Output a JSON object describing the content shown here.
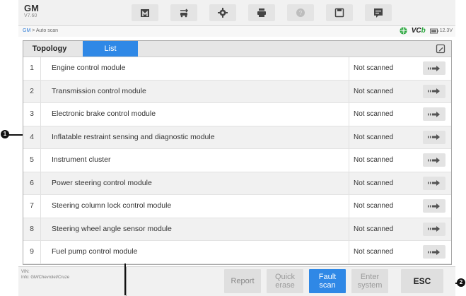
{
  "app": {
    "brand": "GM",
    "version": "V7.60"
  },
  "breadcrumb": {
    "root": "GM",
    "separator": " > ",
    "current": "Auto scan"
  },
  "status": {
    "vci_text": "VC",
    "vci_suffix": "b",
    "battery": "12.3V"
  },
  "toolbar": {
    "icons": [
      "home-icon",
      "vehicle-swap-icon",
      "gear-icon",
      "printer-icon",
      "help-icon",
      "save-icon",
      "data-logging-icon"
    ]
  },
  "tabs": [
    {
      "label": "Topology",
      "active": false
    },
    {
      "label": "List",
      "active": true
    }
  ],
  "modules": [
    {
      "num": "1",
      "name": "Engine control module",
      "status": "Not scanned"
    },
    {
      "num": "2",
      "name": "Transmission control module",
      "status": "Not scanned"
    },
    {
      "num": "3",
      "name": "Electronic brake control module",
      "status": "Not scanned"
    },
    {
      "num": "4",
      "name": "Inflatable restraint sensing and diagnostic module",
      "status": "Not scanned"
    },
    {
      "num": "5",
      "name": "Instrument cluster",
      "status": "Not scanned"
    },
    {
      "num": "6",
      "name": "Power steering control module",
      "status": "Not scanned"
    },
    {
      "num": "7",
      "name": "Steering column lock control module",
      "status": "Not scanned"
    },
    {
      "num": "8",
      "name": "Steering wheel angle sensor module",
      "status": "Not scanned"
    },
    {
      "num": "9",
      "name": "Fuel pump control module",
      "status": "Not scanned"
    }
  ],
  "vehicle": {
    "vin_label": "VIN:",
    "info": "Info: GM/Chevrolet/Cruze"
  },
  "buttons": {
    "report": "Report",
    "quick_erase": [
      "Quick",
      "erase"
    ],
    "fault_scan": [
      "Fault",
      "scan"
    ],
    "enter_system": [
      "Enter",
      "system"
    ],
    "esc": "ESC"
  },
  "callouts": {
    "one": "1",
    "two": "2"
  },
  "colors": {
    "accent": "#2f88e6",
    "vci_green": "#27a53b"
  }
}
